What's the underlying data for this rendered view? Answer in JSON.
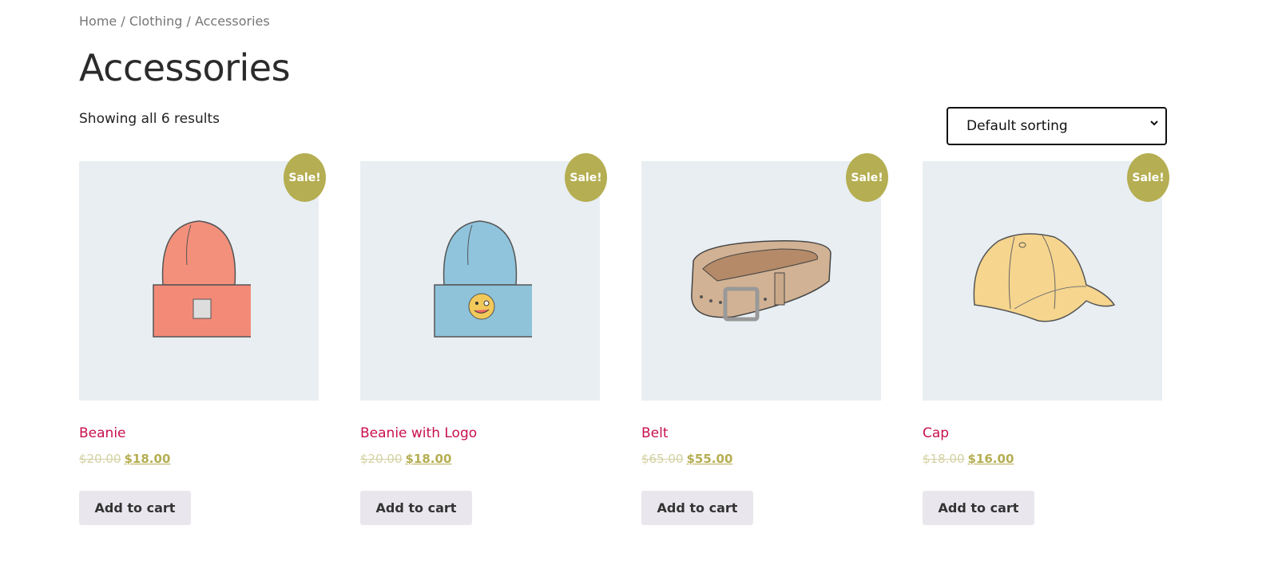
{
  "breadcrumb": {
    "home": "Home",
    "sep": " / ",
    "clothing": "Clothing",
    "current": "Accessories"
  },
  "page_title": "Accessories",
  "result_count": "Showing all 6 results",
  "sorting": {
    "selected": "Default sorting",
    "icon": "chevron-down-icon"
  },
  "colors": {
    "title": "#c8104e",
    "sale_badge": "#b5ae52",
    "image_bg": "#e8eef2",
    "button_bg": "#e9e6ed"
  },
  "products": [
    {
      "name": "Beanie",
      "badge": "Sale!",
      "old_price": "$20.00",
      "price": "$18.00",
      "button": "Add to cart"
    },
    {
      "name": "Beanie with Logo",
      "badge": "Sale!",
      "old_price": "$20.00",
      "price": "$18.00",
      "button": "Add to cart"
    },
    {
      "name": "Belt",
      "badge": "Sale!",
      "old_price": "$65.00",
      "price": "$55.00",
      "button": "Add to cart"
    },
    {
      "name": "Cap",
      "badge": "Sale!",
      "old_price": "$18.00",
      "price": "$16.00",
      "button": "Add to cart"
    }
  ]
}
